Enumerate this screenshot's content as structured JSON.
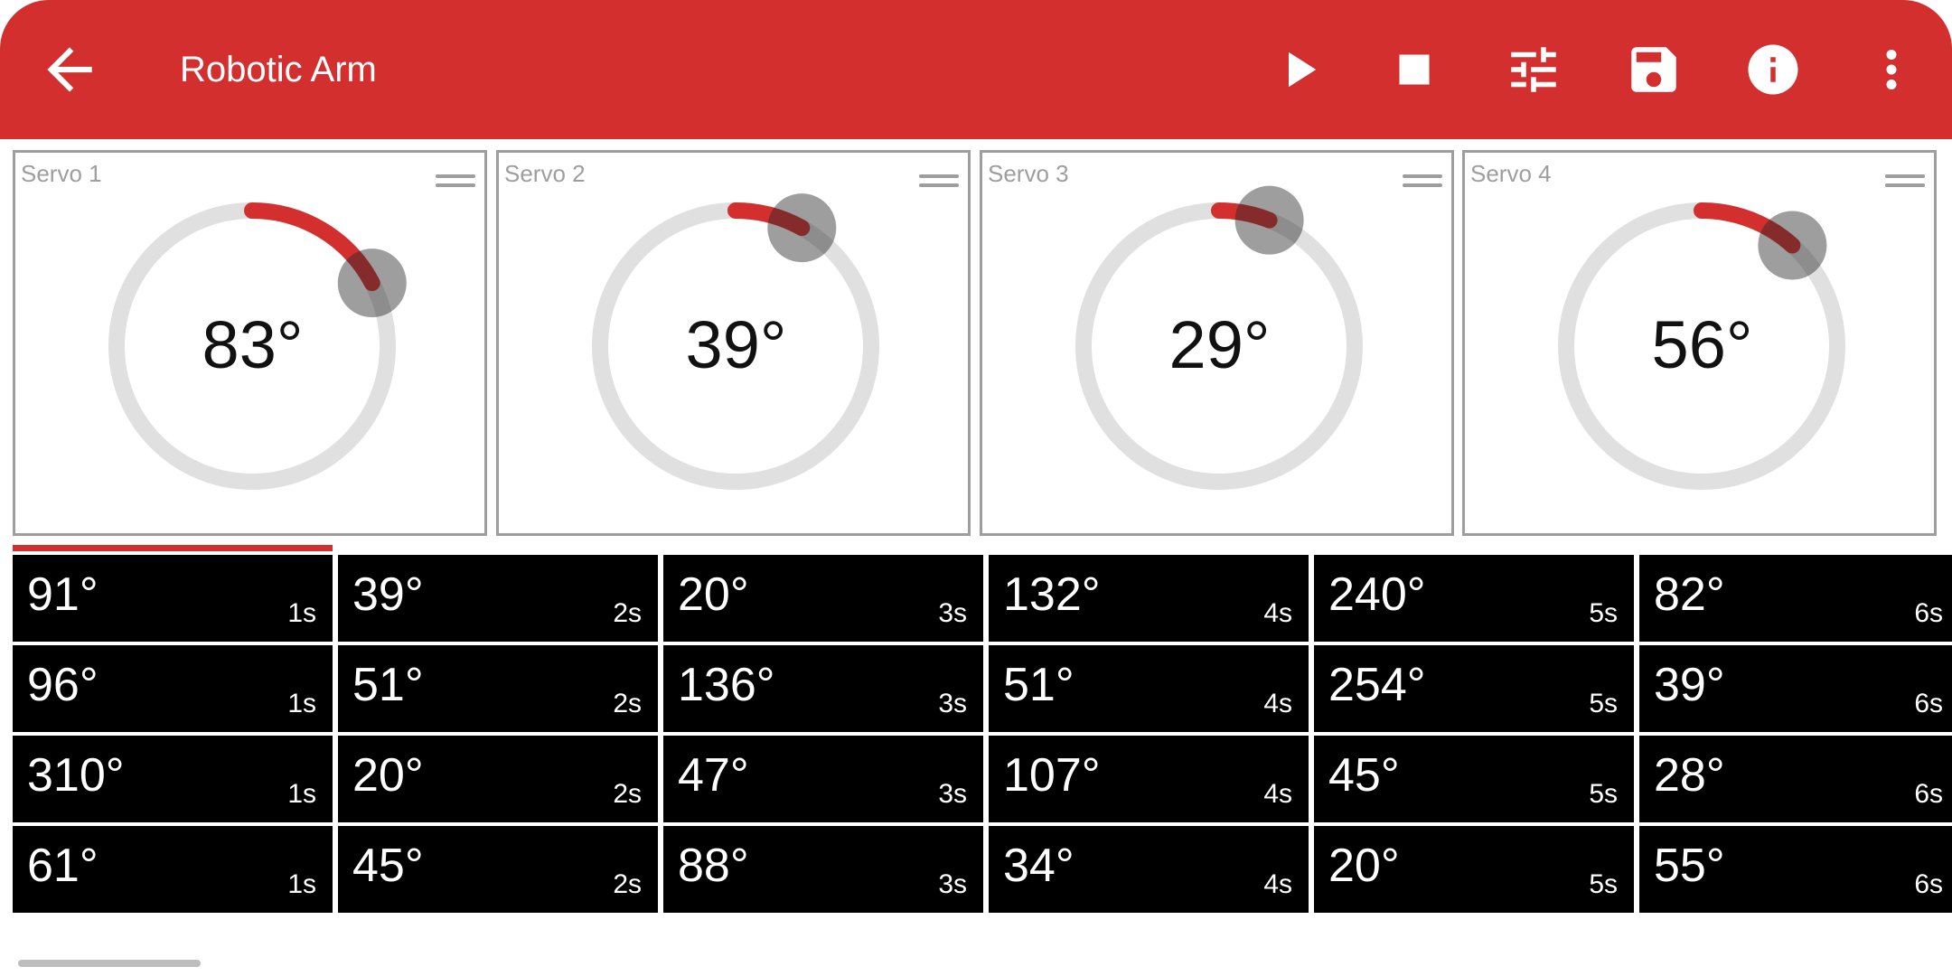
{
  "app": {
    "title": "Robotic Arm",
    "accent": "#d32f2f"
  },
  "toolbar": {
    "icons": [
      "arrow-back-icon",
      "play-icon",
      "stop-icon",
      "tune-icon",
      "save-icon",
      "info-icon",
      "more-vert-icon"
    ]
  },
  "servos": [
    {
      "label": "Servo 1",
      "angle_text": "83°",
      "angle": 83
    },
    {
      "label": "Servo 2",
      "angle_text": "39°",
      "angle": 39
    },
    {
      "label": "Servo 3",
      "angle_text": "29°",
      "angle": 29
    },
    {
      "label": "Servo 4",
      "angle_text": "56°",
      "angle": 56
    }
  ],
  "sequence": {
    "progress_fraction": 0.165,
    "rows": [
      [
        {
          "angle": "91°",
          "time": "1s"
        },
        {
          "angle": "39°",
          "time": "2s"
        },
        {
          "angle": "20°",
          "time": "3s"
        },
        {
          "angle": "132°",
          "time": "4s"
        },
        {
          "angle": "240°",
          "time": "5s"
        },
        {
          "angle": "82°",
          "time": "6s"
        }
      ],
      [
        {
          "angle": "96°",
          "time": "1s"
        },
        {
          "angle": "51°",
          "time": "2s"
        },
        {
          "angle": "136°",
          "time": "3s"
        },
        {
          "angle": "51°",
          "time": "4s"
        },
        {
          "angle": "254°",
          "time": "5s"
        },
        {
          "angle": "39°",
          "time": "6s"
        }
      ],
      [
        {
          "angle": "310°",
          "time": "1s"
        },
        {
          "angle": "20°",
          "time": "2s"
        },
        {
          "angle": "47°",
          "time": "3s"
        },
        {
          "angle": "107°",
          "time": "4s"
        },
        {
          "angle": "45°",
          "time": "5s"
        },
        {
          "angle": "28°",
          "time": "6s"
        }
      ],
      [
        {
          "angle": "61°",
          "time": "1s"
        },
        {
          "angle": "45°",
          "time": "2s"
        },
        {
          "angle": "88°",
          "time": "3s"
        },
        {
          "angle": "34°",
          "time": "4s"
        },
        {
          "angle": "20°",
          "time": "5s"
        },
        {
          "angle": "55°",
          "time": "6s"
        }
      ]
    ]
  }
}
